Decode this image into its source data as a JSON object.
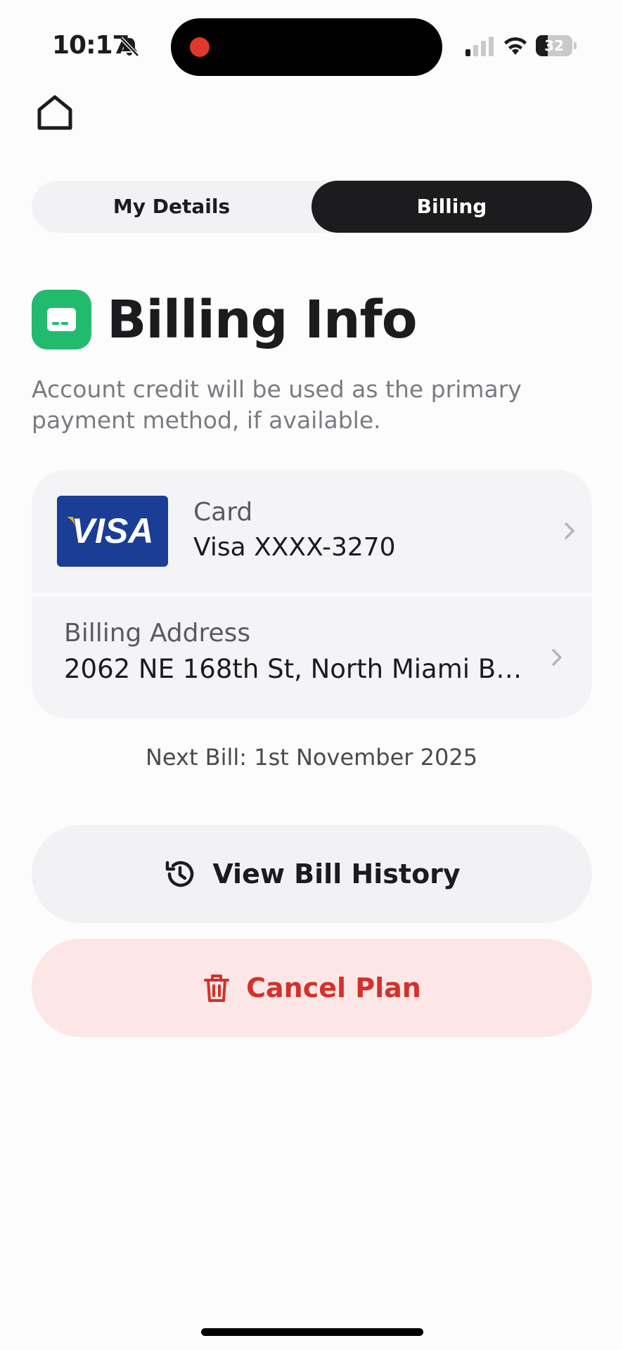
{
  "status_bar": {
    "time": "10:17",
    "battery_level": "32",
    "battery_fraction": 0.32
  },
  "tabs": [
    {
      "label": "My Details",
      "selected": false
    },
    {
      "label": "Billing",
      "selected": true
    }
  ],
  "header": {
    "title": "Billing Info",
    "subtitle": "Account credit will be used as the primary payment method, if available.",
    "badge_color": "#22bb6e"
  },
  "payment": {
    "card_brand": "VISA",
    "card_label": "Card",
    "card_value": "Visa XXXX-3270",
    "address_label": "Billing Address",
    "address_value": "2062 NE 168th St, North Miami Be..."
  },
  "next_bill": "Next Bill: 1st November 2025",
  "actions": {
    "history_label": "View Bill History",
    "cancel_label": "Cancel Plan",
    "cancel_color": "#d4302b"
  },
  "icons": {
    "home": "home-icon",
    "bell_muted": "bell-slash-icon",
    "history": "history-icon",
    "trash": "trash-icon",
    "chevron": "chevron-right-icon",
    "card": "credit-card-icon"
  }
}
